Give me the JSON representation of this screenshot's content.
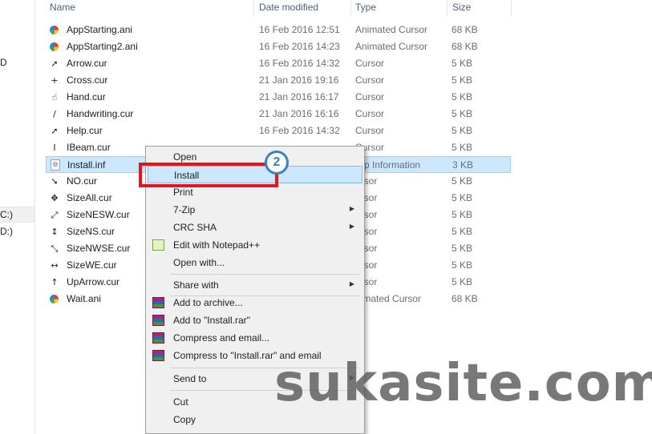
{
  "nav": {
    "frag1": "D",
    "frag2": "C:)",
    "frag3": "D:)"
  },
  "columns": {
    "name": "Name",
    "date": "Date modified",
    "type": "Type",
    "size": "Size"
  },
  "files": [
    {
      "name": "AppStarting.ani",
      "date": "16 Feb 2016 12:51",
      "type": "Animated Cursor",
      "size": "68 KB",
      "icon": "ball"
    },
    {
      "name": "AppStarting2.ani",
      "date": "16 Feb 2016 14:23",
      "type": "Animated Cursor",
      "size": "68 KB",
      "icon": "ball"
    },
    {
      "name": "Arrow.cur",
      "date": "16 Feb 2016 14:32",
      "type": "Cursor",
      "size": "5 KB",
      "icon": "arrow"
    },
    {
      "name": "Cross.cur",
      "date": "21 Jan 2016 19:16",
      "type": "Cursor",
      "size": "5 KB",
      "icon": "cross"
    },
    {
      "name": "Hand.cur",
      "date": "21 Jan 2016 16:17",
      "type": "Cursor",
      "size": "5 KB",
      "icon": "hand"
    },
    {
      "name": "Handwriting.cur",
      "date": "21 Jan 2016 16:16",
      "type": "Cursor",
      "size": "5 KB",
      "icon": "pen"
    },
    {
      "name": "Help.cur",
      "date": "16 Feb 2016 14:32",
      "type": "Cursor",
      "size": "5 KB",
      "icon": "help"
    },
    {
      "name": "IBeam.cur",
      "date": "",
      "type": "Cursor",
      "size": "5 KB",
      "icon": "ibeam"
    },
    {
      "name": "Install.inf",
      "date": "",
      "type": "tup Information",
      "size": "3 KB",
      "icon": "inf"
    },
    {
      "name": "NO.cur",
      "date": "",
      "type": "ursor",
      "size": "5 KB",
      "icon": "no"
    },
    {
      "name": "SizeAll.cur",
      "date": "",
      "type": "ursor",
      "size": "5 KB",
      "icon": "sizeall"
    },
    {
      "name": "SizeNESW.cur",
      "date": "",
      "type": "ursor",
      "size": "5 KB",
      "icon": "nesw"
    },
    {
      "name": "SizeNS.cur",
      "date": "",
      "type": "ursor",
      "size": "5 KB",
      "icon": "ns"
    },
    {
      "name": "SizeNWSE.cur",
      "date": "",
      "type": "ursor",
      "size": "5 KB",
      "icon": "nwse"
    },
    {
      "name": "SizeWE.cur",
      "date": "",
      "type": "ursor",
      "size": "5 KB",
      "icon": "we"
    },
    {
      "name": "UpArrow.cur",
      "date": "",
      "type": "ursor",
      "size": "5 KB",
      "icon": "uparrow"
    },
    {
      "name": "Wait.ani",
      "date": "",
      "type": "nimated Cursor",
      "size": "68 KB",
      "icon": "ball"
    }
  ],
  "menu": {
    "open": "Open",
    "install": "Install",
    "print": "Print",
    "zip": "7-Zip",
    "crc": "CRC SHA",
    "notepad": "Edit with Notepad++",
    "openwith": "Open with...",
    "share": "Share with",
    "addarchive": "Add to archive...",
    "addrar": "Add to \"Install.rar\"",
    "compress": "Compress and email...",
    "compressrar": "Compress to \"Install.rar\" and email",
    "sendto": "Send to",
    "cut": "Cut",
    "copy": "Copy"
  },
  "annotation": {
    "step": "2"
  },
  "watermark": "sukasite.com",
  "colors": {
    "selection": "#cce8ff",
    "highlight_box": "#e3161c",
    "badge": "#3c7fc4"
  }
}
